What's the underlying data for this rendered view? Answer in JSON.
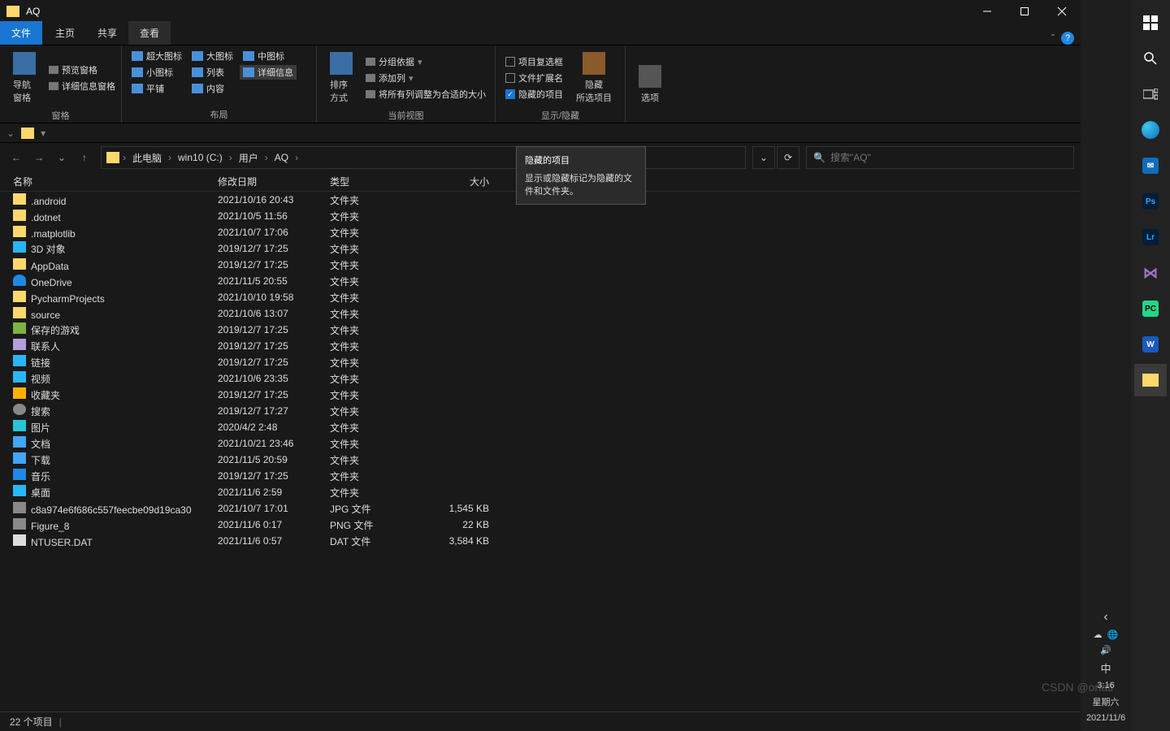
{
  "window": {
    "title": "AQ"
  },
  "tabs": {
    "file": "文件",
    "home": "主页",
    "share": "共享",
    "view": "查看"
  },
  "ribbon": {
    "panes": {
      "nav": {
        "label": "窗格",
        "nav_pane": "导航窗格",
        "preview": "预览窗格",
        "details": "详细信息窗格"
      },
      "layout": {
        "label": "布局",
        "xl": "超大图标",
        "lg": "大图标",
        "md": "中图标",
        "sm": "小图标",
        "list": "列表",
        "det": "详细信息",
        "tile": "平铺",
        "content": "内容"
      },
      "view": {
        "label": "当前视图",
        "sort": "排序方式",
        "group": "分组依据",
        "addcol": "添加列",
        "fitcols": "将所有列调整为合适的大小"
      },
      "show": {
        "label": "显示/隐藏",
        "item_cb": "项目复选框",
        "ext": "文件扩展名",
        "hidden": "隐藏的项目",
        "hide_sel": "隐藏\n所选项目"
      },
      "options": {
        "label": "",
        "options": "选项"
      }
    }
  },
  "breadcrumb": {
    "pc": "此电脑",
    "drive": "win10 (C:)",
    "users": "用户",
    "folder": "AQ"
  },
  "addr_actions": {
    "dd": "⌄",
    "refresh": "⟳"
  },
  "search": {
    "placeholder": "搜索\"AQ\""
  },
  "columns": {
    "name": "名称",
    "date": "修改日期",
    "type": "类型",
    "size": "大小"
  },
  "files": [
    {
      "icon": "ic-folder",
      "name": ".android",
      "date": "2021/10/16 20:43",
      "type": "文件夹",
      "size": ""
    },
    {
      "icon": "ic-folder",
      "name": ".dotnet",
      "date": "2021/10/5 11:56",
      "type": "文件夹",
      "size": ""
    },
    {
      "icon": "ic-folder",
      "name": ".matplotlib",
      "date": "2021/10/7 17:06",
      "type": "文件夹",
      "size": ""
    },
    {
      "icon": "ic-3d",
      "name": "3D 对象",
      "date": "2019/12/7 17:25",
      "type": "文件夹",
      "size": ""
    },
    {
      "icon": "ic-folder",
      "name": "AppData",
      "date": "2019/12/7 17:25",
      "type": "文件夹",
      "size": ""
    },
    {
      "icon": "ic-cloud",
      "name": "OneDrive",
      "date": "2021/11/5 20:55",
      "type": "文件夹",
      "size": ""
    },
    {
      "icon": "ic-folder",
      "name": "PycharmProjects",
      "date": "2021/10/10 19:58",
      "type": "文件夹",
      "size": ""
    },
    {
      "icon": "ic-folder",
      "name": "source",
      "date": "2021/10/6 13:07",
      "type": "文件夹",
      "size": ""
    },
    {
      "icon": "ic-game",
      "name": "保存的游戏",
      "date": "2019/12/7 17:25",
      "type": "文件夹",
      "size": ""
    },
    {
      "icon": "ic-contact",
      "name": "联系人",
      "date": "2019/12/7 17:25",
      "type": "文件夹",
      "size": ""
    },
    {
      "icon": "ic-link",
      "name": "链接",
      "date": "2019/12/7 17:25",
      "type": "文件夹",
      "size": ""
    },
    {
      "icon": "ic-video",
      "name": "视频",
      "date": "2021/10/6 23:35",
      "type": "文件夹",
      "size": ""
    },
    {
      "icon": "ic-star",
      "name": "收藏夹",
      "date": "2019/12/7 17:25",
      "type": "文件夹",
      "size": ""
    },
    {
      "icon": "ic-search",
      "name": "搜索",
      "date": "2019/12/7 17:27",
      "type": "文件夹",
      "size": ""
    },
    {
      "icon": "ic-pic",
      "name": "图片",
      "date": "2020/4/2 2:48",
      "type": "文件夹",
      "size": ""
    },
    {
      "icon": "ic-doc",
      "name": "文档",
      "date": "2021/10/21 23:46",
      "type": "文件夹",
      "size": ""
    },
    {
      "icon": "ic-down",
      "name": "下载",
      "date": "2021/11/5 20:59",
      "type": "文件夹",
      "size": ""
    },
    {
      "icon": "ic-music",
      "name": "音乐",
      "date": "2019/12/7 17:25",
      "type": "文件夹",
      "size": ""
    },
    {
      "icon": "ic-desk",
      "name": "桌面",
      "date": "2021/11/6 2:59",
      "type": "文件夹",
      "size": ""
    },
    {
      "icon": "ic-jpg",
      "name": "c8a974e6f686c557feecbe09d19ca30",
      "date": "2021/10/7 17:01",
      "type": "JPG 文件",
      "size": "1,545 KB"
    },
    {
      "icon": "ic-png",
      "name": "Figure_8",
      "date": "2021/11/6 0:17",
      "type": "PNG 文件",
      "size": "22 KB"
    },
    {
      "icon": "ic-dat",
      "name": "NTUSER.DAT",
      "date": "2021/11/6 0:57",
      "type": "DAT 文件",
      "size": "3,584 KB"
    }
  ],
  "status": {
    "count": "22 个项目"
  },
  "tooltip": {
    "title": "隐藏的项目",
    "body": "显示或隐藏标记为隐藏的文件和文件夹。"
  },
  "tray": {
    "ime": "中",
    "time": "3:16",
    "day": "星期六",
    "date": "2021/11/6",
    "chev": "‹"
  },
  "watermark": "CSDN @oriatl"
}
